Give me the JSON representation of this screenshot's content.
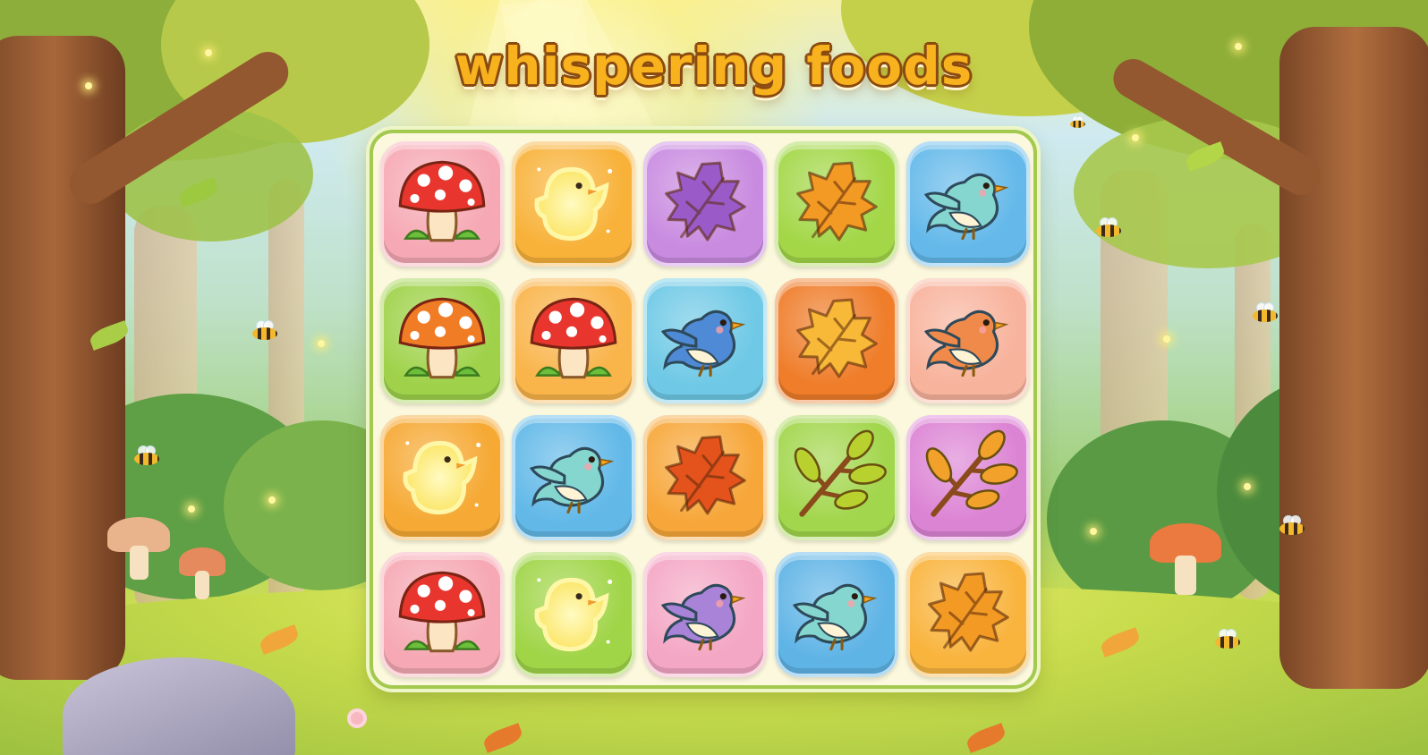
{
  "game": {
    "title": "whispering foods"
  },
  "board": {
    "rows": 4,
    "cols": 5,
    "tiles": [
      {
        "item": "mushroom-icon",
        "variant": "red",
        "bg": "#f6a9b4"
      },
      {
        "item": "chick-icon",
        "variant": "glow",
        "bg": "#f8b23a"
      },
      {
        "item": "leaf-icon",
        "variant": "purple",
        "bg": "#c98be0"
      },
      {
        "item": "leaf-icon",
        "variant": "orange",
        "bg": "#a3d748"
      },
      {
        "item": "bird-icon",
        "variant": "teal",
        "bg": "#64b9ea"
      },
      {
        "item": "mushroom-icon",
        "variant": "orange",
        "bg": "#9fd24a"
      },
      {
        "item": "mushroom-icon",
        "variant": "red",
        "bg": "#f9b44a"
      },
      {
        "item": "bird-icon",
        "variant": "blue",
        "bg": "#6fc9e6"
      },
      {
        "item": "leaf-icon",
        "variant": "gold",
        "bg": "#ef7d2a"
      },
      {
        "item": "bird-icon",
        "variant": "orange",
        "bg": "#f8b39c"
      },
      {
        "item": "chick-icon",
        "variant": "glow",
        "bg": "#f6a934"
      },
      {
        "item": "bird-icon",
        "variant": "teal",
        "bg": "#62b9e8"
      },
      {
        "item": "leaf-icon",
        "variant": "red-orange",
        "bg": "#f7a73a"
      },
      {
        "item": "branch-icon",
        "variant": "green",
        "bg": "#a2d64c"
      },
      {
        "item": "branch-icon",
        "variant": "autumn",
        "bg": "#dc84d4"
      },
      {
        "item": "mushroom-icon",
        "variant": "red",
        "bg": "#f6a9b4"
      },
      {
        "item": "chick-icon",
        "variant": "glow",
        "bg": "#a0d548"
      },
      {
        "item": "bird-icon",
        "variant": "purple",
        "bg": "#f4a7c4"
      },
      {
        "item": "bird-icon",
        "variant": "teal",
        "bg": "#5fb4e6"
      },
      {
        "item": "leaf-icon",
        "variant": "orange",
        "bg": "#f9b43e"
      }
    ]
  },
  "colors": {
    "title_fill": "#f7b21e",
    "title_outline": "#8a4a10",
    "board_border": "#a3c94f",
    "board_bg": "#fbf8dd"
  }
}
